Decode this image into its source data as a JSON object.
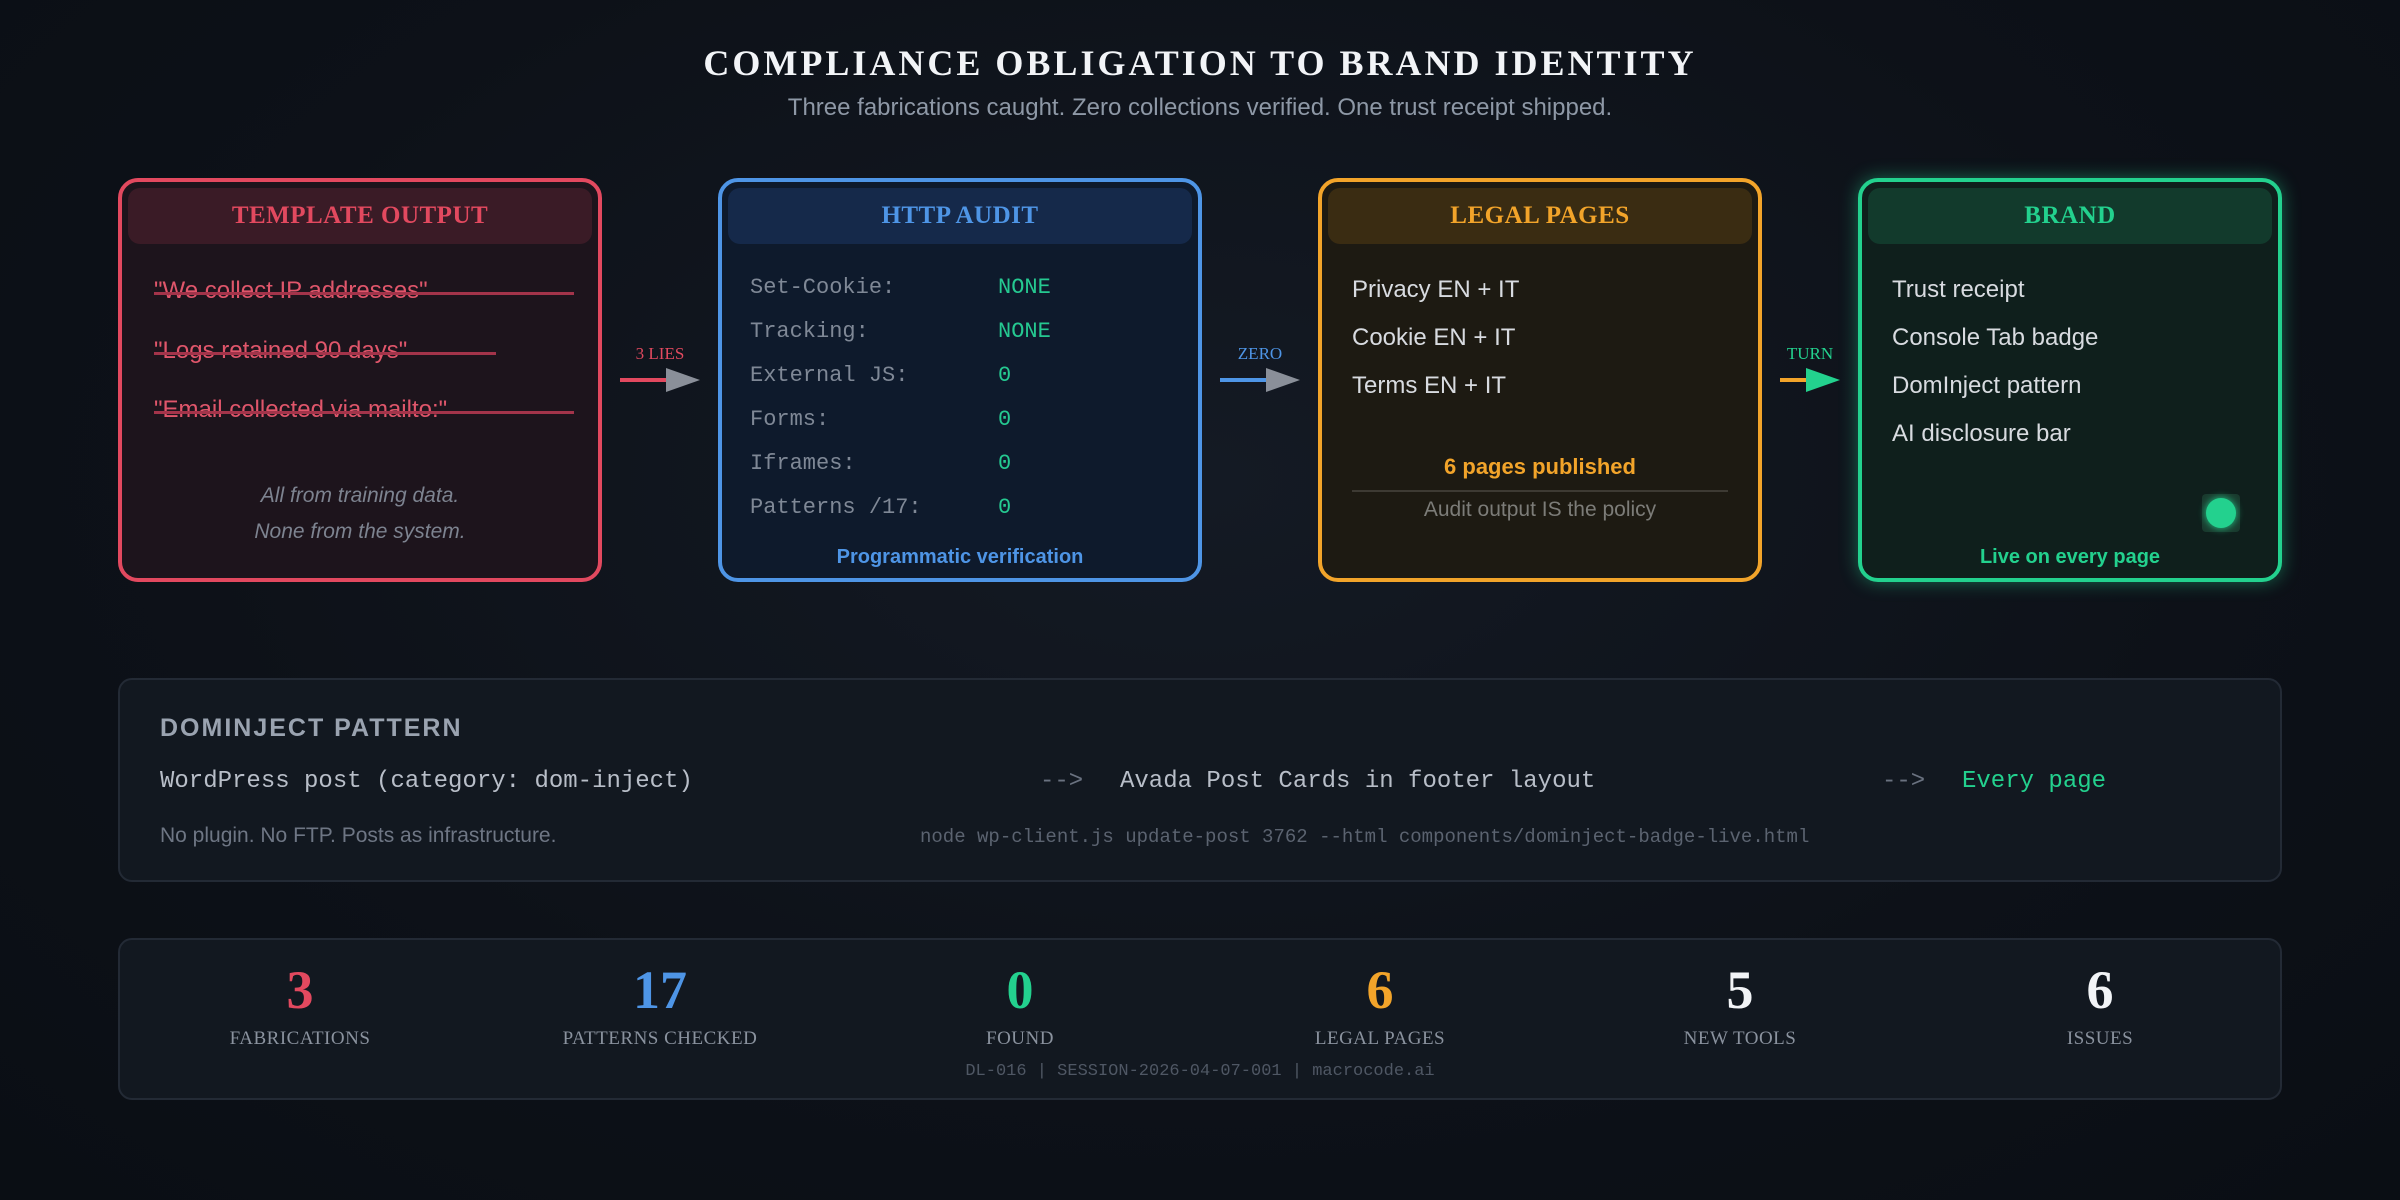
{
  "title": "COMPLIANCE OBLIGATION TO BRAND IDENTITY",
  "subtitle": "Three fabrications caught. Zero collections verified. One trust receipt shipped.",
  "colors": {
    "red": "#e2495f",
    "blue": "#4e95e6",
    "orange": "#f2a42a",
    "green": "#23d18e"
  },
  "cards": {
    "template": {
      "title": "TEMPLATE OUTPUT",
      "lies": [
        "\"We collect IP addresses\"",
        "\"Logs retained 90 days\"",
        "\"Email collected via mailto:\""
      ],
      "note_line1": "All from training data.",
      "note_line2": "None from the system."
    },
    "http": {
      "title": "HTTP AUDIT",
      "rows": [
        {
          "label": "Set-Cookie:",
          "value": "NONE"
        },
        {
          "label": "Tracking:",
          "value": "NONE"
        },
        {
          "label": "External JS:",
          "value": "0"
        },
        {
          "label": "Forms:",
          "value": "0"
        },
        {
          "label": "Iframes:",
          "value": "0"
        },
        {
          "label": "Patterns /17:",
          "value": "0"
        }
      ],
      "footer": "Programmatic verification"
    },
    "legal": {
      "title": "LEGAL PAGES",
      "items": [
        "Privacy EN + IT",
        "Cookie EN + IT",
        "Terms EN + IT"
      ],
      "highlight": "6 pages published",
      "note": "Audit output IS the policy"
    },
    "brand": {
      "title": "BRAND",
      "items": [
        "Trust receipt",
        "Console Tab badge",
        "DomInject pattern",
        "AI disclosure bar"
      ],
      "footer": "Live on every page"
    }
  },
  "connectors": [
    "3 LIES",
    "ZERO",
    "TURN"
  ],
  "dominject": {
    "heading": "DOMINJECT PATTERN",
    "step1": "WordPress post (category: dom-inject)",
    "arrow": "-->",
    "step2": "Avada Post Cards in footer layout",
    "step3": "Every page",
    "note": "No plugin. No FTP. Posts as infrastructure.",
    "command": "node wp-client.js update-post 3762 --html components/dominject-badge-live.html"
  },
  "stats": {
    "items": [
      {
        "value": "3",
        "label": "FABRICATIONS",
        "color": "#e2495f"
      },
      {
        "value": "17",
        "label": "PATTERNS CHECKED",
        "color": "#4e95e6"
      },
      {
        "value": "0",
        "label": "FOUND",
        "color": "#23d18e"
      },
      {
        "value": "6",
        "label": "LEGAL PAGES",
        "color": "#f2a42a"
      },
      {
        "value": "5",
        "label": "NEW TOOLS",
        "color": "#f2f4f7"
      },
      {
        "value": "6",
        "label": "ISSUES",
        "color": "#f2f4f7"
      }
    ],
    "footer": "DL-016 | SESSION-2026-04-07-001 | macrocode.ai"
  }
}
